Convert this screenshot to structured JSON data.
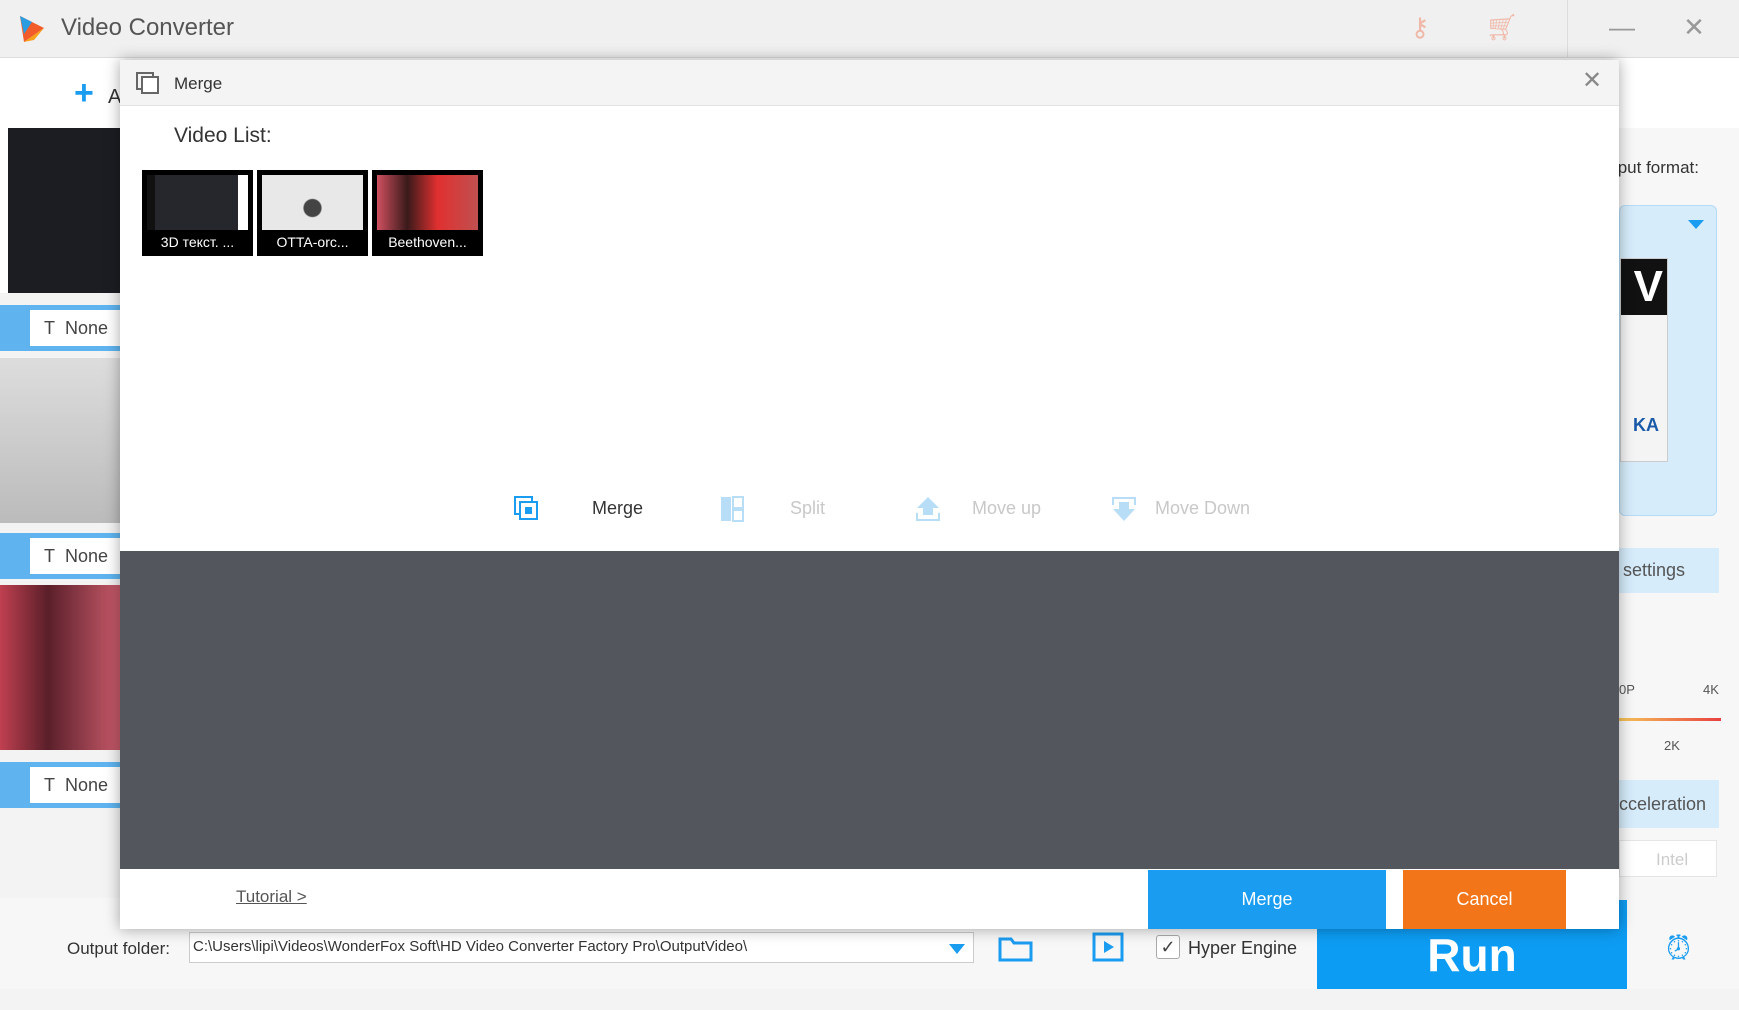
{
  "app": {
    "title": "Video Converter",
    "add_label": "A"
  },
  "left_list": {
    "subtitle_labels": [
      "None",
      "None",
      "None"
    ]
  },
  "right_panel": {
    "output_format_label": "tput format:",
    "format_badge_top": "V",
    "format_badge_bottom": "KA",
    "settings_label": "settings",
    "slider_labels": {
      "left": "0P",
      "right": "4K",
      "mid": "2K"
    },
    "acceleration_label": "cceleration",
    "intel_label": "Intel"
  },
  "bottom": {
    "output_folder_label": "Output folder:",
    "output_path": "C:\\Users\\lipi\\Videos\\WonderFox Soft\\HD Video Converter Factory Pro\\OutputVideo\\",
    "hyper_engine_label": "Hyper Engine",
    "hyper_engine_checked": true,
    "run_label": "Run"
  },
  "dialog": {
    "title": "Merge",
    "video_list_label": "Video List:",
    "videos": [
      {
        "name": "3D текст. ..."
      },
      {
        "name": "OTTA-orc..."
      },
      {
        "name": "Beethoven..."
      }
    ],
    "tools": {
      "merge": "Merge",
      "split": "Split",
      "move_up": "Move up",
      "move_down": "Move Down"
    },
    "tutorial_link": "Tutorial >",
    "merge_button": "Merge",
    "cancel_button": "Cancel"
  },
  "colors": {
    "accent": "#1a9cf0",
    "cancel": "#f2751a",
    "dark_area": "#53575d"
  }
}
